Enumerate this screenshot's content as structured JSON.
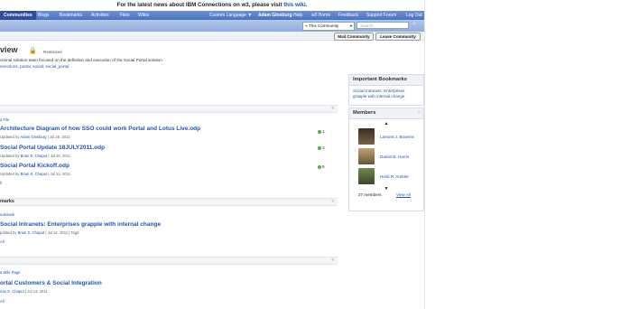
{
  "banner": {
    "text": "For the latest news about IBM Connections on w3, please visit",
    "link": "this wiki."
  },
  "topnav": {
    "items": [
      "Communities",
      "Blogs",
      "Bookmarks",
      "Activities",
      "Files",
      "Wikis"
    ],
    "right": [
      "Custom Language ▼",
      "Adam Ginsburg",
      "Help",
      "w3 Home",
      "Feedback",
      "Support Forum",
      "Log Out"
    ]
  },
  "search": {
    "scope": "This Community",
    "placeholder": "Search"
  },
  "actions": {
    "mail": "Mail Community",
    "leave": "Leave Community"
  },
  "community": {
    "title": "view",
    "restricted": "Restricted",
    "description": "ctional solution team focused on the definition and execution of the Social Portal solution.",
    "tags": "nnections, portal, social, social_portal"
  },
  "files": {
    "upload_link": "a File",
    "items": [
      {
        "title": "Architecture Diagram of how SSO could work Portal and Lotus Live.odp",
        "updated_prefix": "Updated by",
        "author": "Adam Ginsburg",
        "date": "| Jul 26, 2011",
        "count": "1"
      },
      {
        "title": "Social Portal Update 18JULY2011.odp",
        "updated_prefix": "Updated by",
        "author": "Brian S. Chaput",
        "date": "| Jul 20, 2011",
        "count": "3"
      },
      {
        "title": "Social Portal Kickoff.odp",
        "updated_prefix": "Updated by",
        "author": "Brian S. Chaput",
        "date": "| Jul 12, 2011",
        "count": "9"
      }
    ],
    "view_all": "ll"
  },
  "bookmarks": {
    "heading": "marks",
    "add_link": "ookmark",
    "item_title": "Social Intranets: Enterprises grapple with internal change",
    "item_prefix": "pdated by",
    "item_author": "Brian S. Chaput",
    "item_date": "| Jul 12, 2011 | Tags:",
    "view_all": "All"
  },
  "wiki": {
    "add_link": "a Wiki Page",
    "item_title": "ortal Customers & Social Integration",
    "item_author": "rian S. Chaput",
    "item_date": "| Jul 13, 2011",
    "view_all": "All"
  },
  "important_bookmarks": {
    "heading": "Important Bookmarks",
    "link": "Social Intranets: Enterprises grapple with internal change"
  },
  "members": {
    "heading": "Members",
    "list": [
      "Lamont J. Bowens",
      "Daniel B. Harris",
      "Heidi R. Ambler"
    ],
    "count": "27 members",
    "view_all": "View All"
  },
  "colors": {
    "nav": "#4a73bf",
    "link": "#1a56b8"
  }
}
